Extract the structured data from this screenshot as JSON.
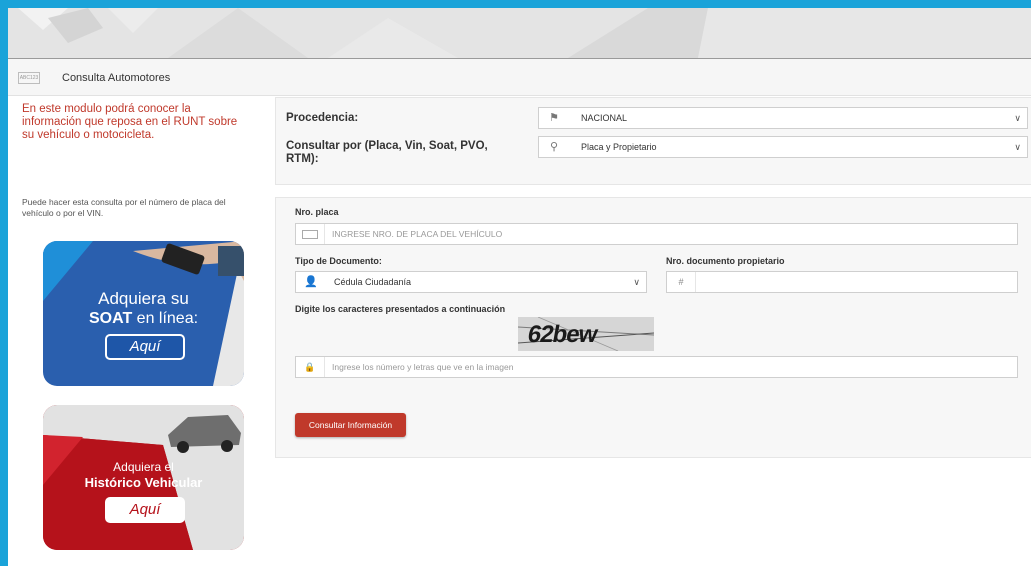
{
  "header": {
    "badge_text": "ABC123",
    "title": "Consulta Automotores"
  },
  "sidebar": {
    "intro_text": "En este modulo podrá conocer la información que reposa en el RUNT sobre su vehículo o motocicleta.",
    "hint_text": "Puede hacer esta consulta por el número de placa del vehículo o por el VIN.",
    "ad_soat": {
      "line1": "Adquiera su",
      "line2_bold": "SOAT",
      "line2_rest": " en línea:",
      "button": "Aquí"
    },
    "ad_historico": {
      "line1": "Adquiera el",
      "line2": "Histórico Vehicular",
      "button": "Aquí"
    }
  },
  "filters": {
    "procedencia_label": "Procedencia:",
    "procedencia_value": "NACIONAL",
    "consultar_label": "Consultar por (Placa, Vin, Soat, PVO, RTM):",
    "consultar_value": "Placa y Propietario"
  },
  "form": {
    "placa_label": "Nro. placa",
    "placa_placeholder": "INGRESE NRO. DE PLACA DEL VEHÍCULO",
    "tipo_doc_label": "Tipo de Documento:",
    "tipo_doc_value": "Cédula Ciudadanía",
    "nro_doc_label": "Nro. documento propietario",
    "nro_doc_icon": "#",
    "captcha_label": "Digite los caracteres presentados a continuación",
    "captcha_text": "62bew",
    "captcha_placeholder": "Ingrese los número y letras que ve en la imagen",
    "submit_label": "Consultar Información"
  },
  "icons": {
    "procedencia": "flag-map-icon",
    "consultar": "search-person-icon",
    "placa": "license-plate-icon",
    "tipo_doc": "user-icon",
    "captcha": "lock-icon",
    "chevron": "chevron-down-icon"
  },
  "colors": {
    "frame": "#1aa3d9",
    "accent_red": "#c0392b",
    "soat_blue": "#2a5fae",
    "historico_red": "#b5121b"
  }
}
